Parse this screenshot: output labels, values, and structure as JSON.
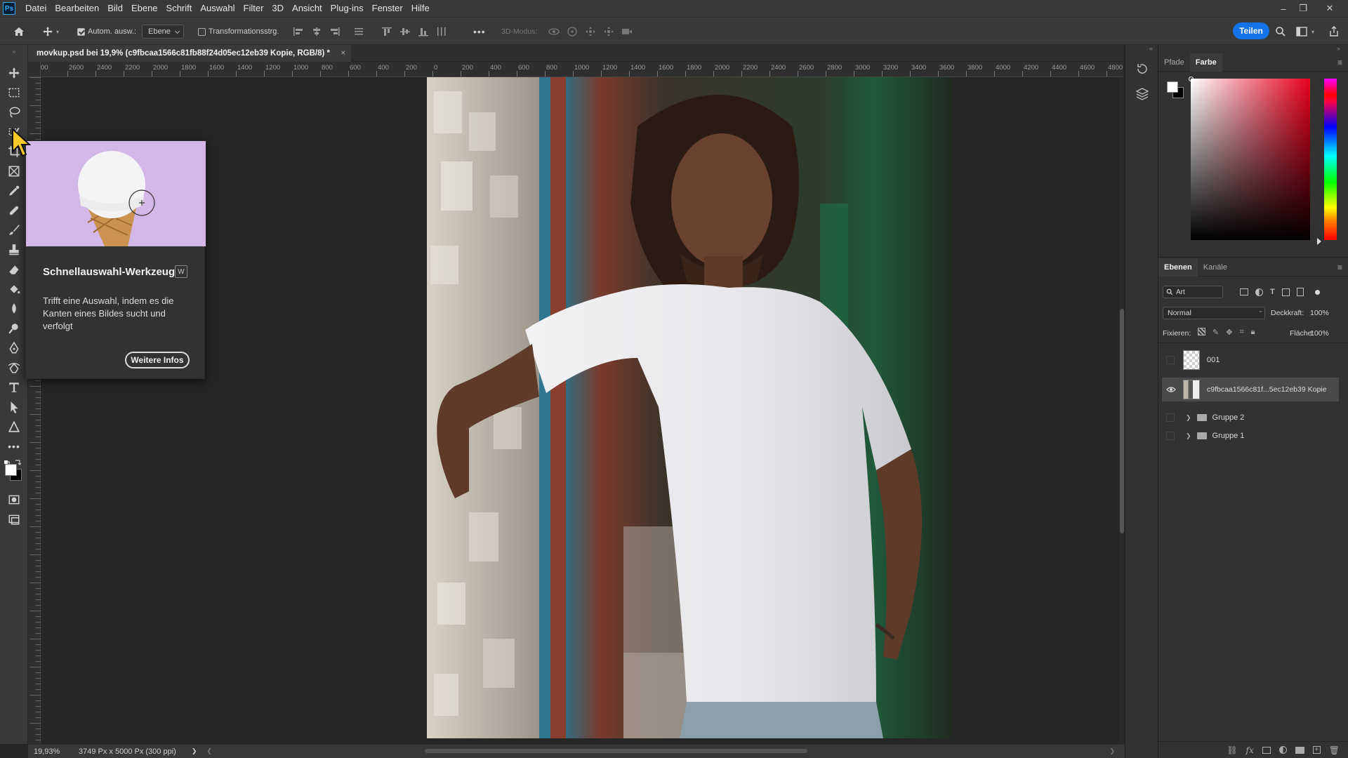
{
  "app": {
    "logo": "Ps"
  },
  "menubar": {
    "items": [
      "Datei",
      "Bearbeiten",
      "Bild",
      "Ebene",
      "Schrift",
      "Auswahl",
      "Filter",
      "3D",
      "Ansicht",
      "Plug-ins",
      "Fenster",
      "Hilfe"
    ]
  },
  "window_controls": {
    "minimize": "–",
    "restore": "❐",
    "close": "✕"
  },
  "options": {
    "auto_select_label": "Autom. ausw.:",
    "auto_select_checked": true,
    "auto_select_target": "Ebene",
    "transform_label": "Transformationsstrg.",
    "transform_checked": false,
    "more": "•••",
    "mode3d_label": "3D-Modus:",
    "share_label": "Teilen"
  },
  "document": {
    "tab_title": "movkup.psd bei 19,9% (c9fbcaa1566c81fb88f24d05ec12eb39 Kopie, RGB/8) *",
    "close": "×"
  },
  "ruler": {
    "top_ticks": [
      "00",
      "2600",
      "2400",
      "2200",
      "2000",
      "1800",
      "1600",
      "1400",
      "1200",
      "1000",
      "800",
      "600",
      "400",
      "200",
      "0",
      "200",
      "400",
      "600",
      "800",
      "1000",
      "1200",
      "1400",
      "1600",
      "1800",
      "2000",
      "2200",
      "2400",
      "2600",
      "2800",
      "3000",
      "3200",
      "3400",
      "3600",
      "3800",
      "4000",
      "4200",
      "4400",
      "4600",
      "4800"
    ]
  },
  "status": {
    "zoom": "19,93%",
    "doc_info": "3749 Px x 5000 Px (300 ppi)",
    "arrow": "❯"
  },
  "tooltip": {
    "title": "Schnellauswahl-Werkzeug",
    "shortcut": "W",
    "description": "Trifft eine Auswahl, indem es die Kanten eines Bildes sucht und verfolgt",
    "more_button": "Weitere Infos"
  },
  "color_panel": {
    "tabs": [
      "Pfade",
      "Farbe"
    ],
    "active_tab": "Farbe",
    "foreground": "#ffffff",
    "background": "#000000",
    "hue_color": "#e8001c"
  },
  "layers_panel": {
    "tabs": [
      "Ebenen",
      "Kanäle"
    ],
    "active_tab": "Ebenen",
    "filter_label": "Art",
    "blend_mode": "Normal",
    "opacity_label": "Deckkraft:",
    "opacity_value": "100%",
    "lock_label": "Fixieren:",
    "fill_label": "Fläche:",
    "fill_value": "100%",
    "layers": [
      {
        "name": "001",
        "type": "smart-object",
        "visible": false,
        "selected": false
      },
      {
        "name": "c9fbcaa1566c81f...5ec12eb39 Kopie",
        "type": "smart-object",
        "visible": true,
        "selected": true
      },
      {
        "name": "Gruppe 2",
        "type": "group",
        "visible": false,
        "selected": false
      },
      {
        "name": "Gruppe 1",
        "type": "group",
        "visible": false,
        "selected": false
      }
    ]
  },
  "icons": {
    "toolbar": [
      "move-icon",
      "marquee-icon",
      "lasso-icon",
      "quick-selection-icon",
      "crop-icon",
      "frame-icon",
      "eyedropper-icon",
      "healing-icon",
      "brush-icon",
      "stamp-icon",
      "eraser-icon",
      "paint-bucket-icon",
      "blur-icon",
      "dodge-icon",
      "pen-icon",
      "curvature-pen-icon",
      "type-icon",
      "path-select-icon",
      "shape-icon",
      "more-tools-icon",
      "quick-mask-icon",
      "screen-mode-icon"
    ]
  }
}
